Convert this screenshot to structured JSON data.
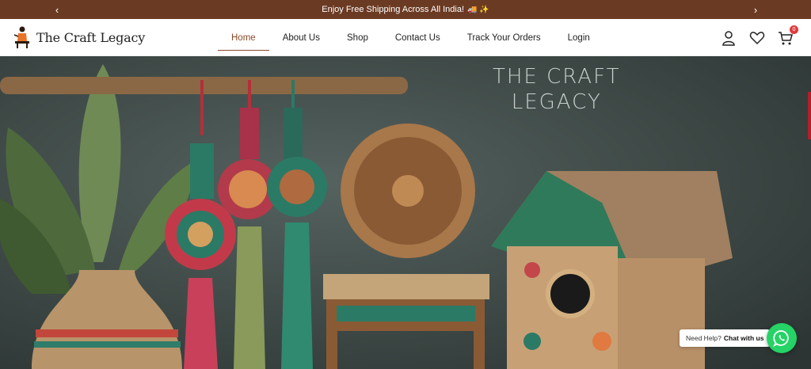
{
  "announcement": {
    "text": "Enjoy Free Shipping Across All India!",
    "emoji": "🚚 ✨",
    "prev_icon": "chevron-left-icon",
    "next_icon": "chevron-right-icon"
  },
  "brand": {
    "name": "The Craft Legacy"
  },
  "nav": {
    "items": [
      {
        "label": "Home",
        "active": true
      },
      {
        "label": "About Us",
        "active": false
      },
      {
        "label": "Shop",
        "active": false
      },
      {
        "label": "Contact Us",
        "active": false
      },
      {
        "label": "Track Your Orders",
        "active": false
      },
      {
        "label": "Login",
        "active": false
      }
    ]
  },
  "header_icons": {
    "account": "user-icon",
    "wishlist": "heart-icon",
    "cart": "cart-icon",
    "cart_count": "0"
  },
  "hero": {
    "title_line1": "THE CRAFT",
    "title_line2": "LEGACY"
  },
  "help": {
    "prefix": "Need Help?",
    "action": "Chat with us",
    "icon": "whatsapp-icon"
  },
  "colors": {
    "topbar": "#6b3a22",
    "accent": "#8a4a2a",
    "whatsapp": "#25d366",
    "badge": "#e23a3a"
  }
}
